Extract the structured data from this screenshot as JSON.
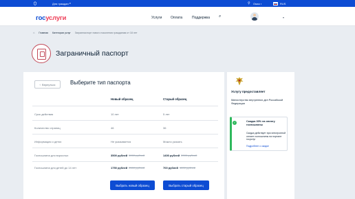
{
  "colors": {
    "brand_blue": "#0d4cd3",
    "brand_red": "#ee3f58",
    "success_green": "#2eb85c"
  },
  "topbar": {
    "emblem_icon": "coat-of-arms-icon",
    "for_citizens": "Для граждан",
    "location_icon": "map-pin-icon",
    "city": "Омск г",
    "language": "RUS"
  },
  "header": {
    "logo_part1": "гос",
    "logo_part2": "услуги",
    "nav": [
      "Услуги",
      "Оплата",
      "Поддержка"
    ],
    "search_icon": "search-icon"
  },
  "breadcrumbs": {
    "home": "Главная",
    "category": "Категории услуг",
    "current": "Загранпаспорт нового поколения гражданам от 18 лет"
  },
  "page": {
    "title": "Заграничный паспорт",
    "back_label": "Вернуться",
    "select_heading": "Выберите тип паспорта"
  },
  "table": {
    "columns": [
      "Новый образец",
      "Старый образец"
    ],
    "rows": [
      {
        "label": "Срок действия",
        "new": "10 лет",
        "old": "5 лет"
      },
      {
        "label": "Количество страниц",
        "new": "46",
        "old": "36"
      },
      {
        "label": "Информация о детях",
        "new": "Не указывается",
        "old": "Можно указать"
      },
      {
        "label": "Госпошлина для взрослых",
        "new": "3500 рублей",
        "new_strike": "5000 рублей",
        "old": "1400 рублей",
        "old_strike": "2000 рублей"
      },
      {
        "label": "Госпошлина для детей до 14 лет",
        "new": "1750 рублей",
        "new_strike": "2500 рублей",
        "old": "700 рублей",
        "old_strike": "1000 рублей"
      }
    ],
    "buttons": [
      "Выбрать новый образец",
      "Выбрать старый образец"
    ]
  },
  "sidebar": {
    "provider_title": "Услугу предоставляет",
    "provider_name": "Министерство внутренних дел Российской Федерации",
    "discount_title": "Скидка 30% на оплату госпошлины",
    "discount_text": "Скидка действует при электронной оплате госпошлины на портале госуслуг",
    "discount_link": "Подробнее о скидке"
  }
}
